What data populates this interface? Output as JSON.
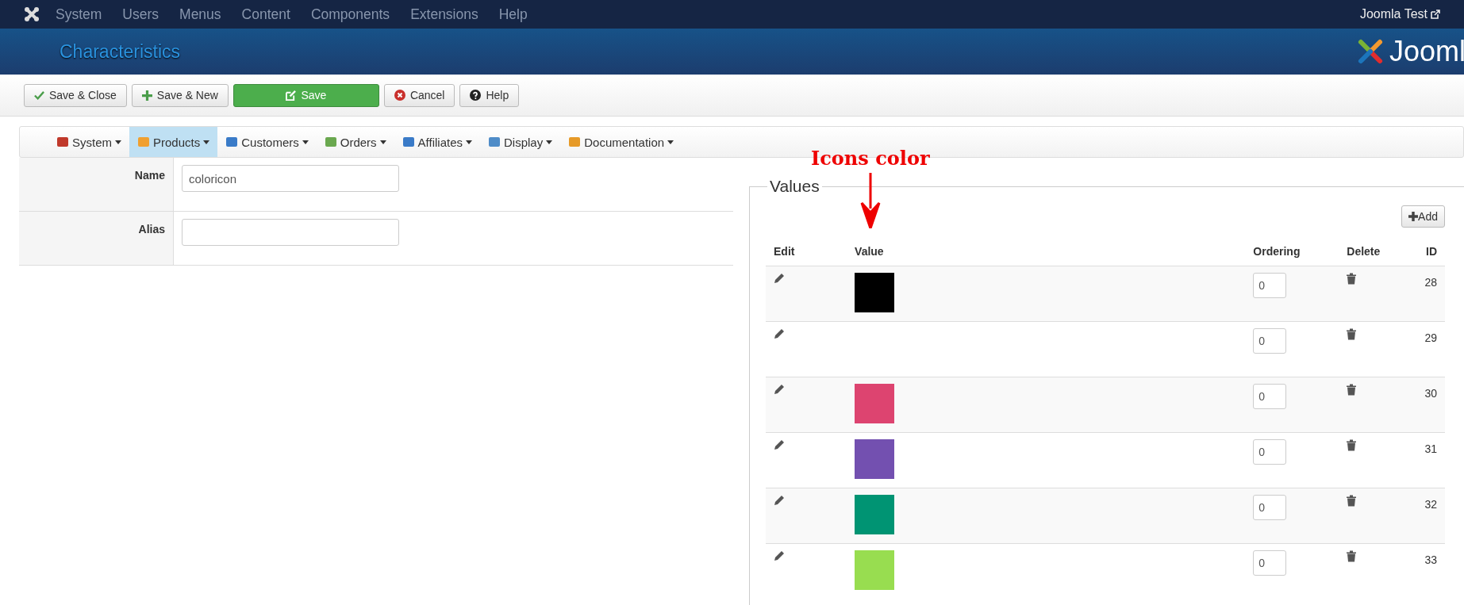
{
  "top_menu": {
    "items": [
      "System",
      "Users",
      "Menus",
      "Content",
      "Components",
      "Extensions",
      "Help"
    ],
    "site_link": "Joomla Test"
  },
  "header": {
    "title": "Characteristics",
    "logo_text": "Jooml"
  },
  "toolbar": [
    {
      "kind": "check",
      "label": "Save & Close"
    },
    {
      "kind": "plus",
      "label": "Save & New"
    },
    {
      "kind": "save",
      "label": "Save"
    },
    {
      "kind": "cancel",
      "label": "Cancel"
    },
    {
      "kind": "help",
      "label": "Help"
    }
  ],
  "submenu": [
    {
      "label": "System",
      "selected": false
    },
    {
      "label": "Products",
      "selected": true
    },
    {
      "label": "Customers",
      "selected": false
    },
    {
      "label": "Orders",
      "selected": false
    },
    {
      "label": "Affiliates",
      "selected": false
    },
    {
      "label": "Display",
      "selected": false
    },
    {
      "label": "Documentation",
      "selected": false
    }
  ],
  "form": [
    {
      "label": "Name",
      "value": "coloricon"
    },
    {
      "label": "Alias"
    }
  ],
  "values": {
    "legend": "Values",
    "annotation": "Icons color",
    "add_button": "Add",
    "columns": [
      "Edit",
      "Value",
      "Ordering",
      "Delete",
      "ID"
    ],
    "rows": [
      {
        "color": "#000000",
        "ordering": "0",
        "id": "28"
      },
      {
        "ordering": "0",
        "id": "29"
      },
      {
        "color": "#dd4470",
        "ordering": "0",
        "id": "30"
      },
      {
        "color": "#7350b0",
        "ordering": "0",
        "id": "31"
      },
      {
        "color": "#009473",
        "ordering": "0",
        "id": "32"
      },
      {
        "color": "#98dd50",
        "ordering": "0",
        "id": "33"
      }
    ]
  }
}
